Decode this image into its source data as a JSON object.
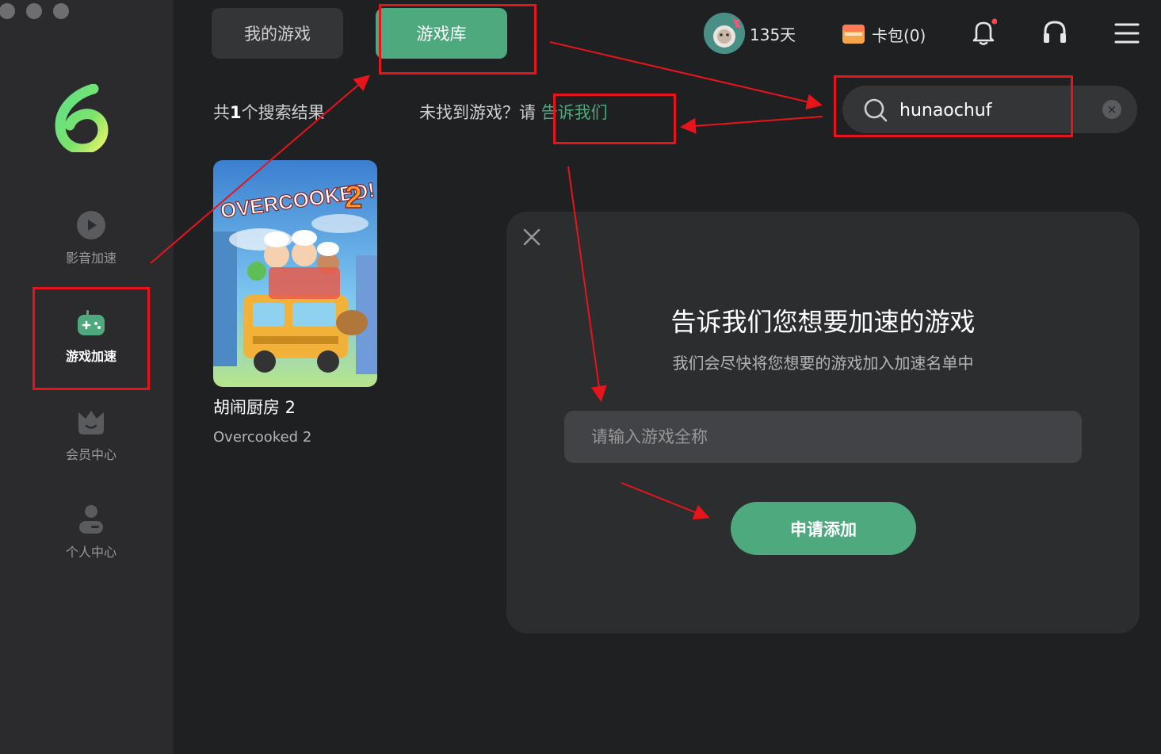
{
  "sidebar": {
    "items": [
      {
        "label": "影音加速",
        "icon": "play-circle-icon"
      },
      {
        "label": "游戏加速",
        "icon": "gamepad-icon"
      },
      {
        "label": "会员中心",
        "icon": "crown-icon"
      },
      {
        "label": "个人中心",
        "icon": "person-icon"
      }
    ]
  },
  "tabs": {
    "mine": "我的游戏",
    "library": "游戏库"
  },
  "header": {
    "days": "135天",
    "wallet": "卡包(0)"
  },
  "search": {
    "value": "hunaochuf",
    "clear": "×"
  },
  "results": {
    "count_prefix": "共",
    "count": "1",
    "count_suffix": "个搜索结果",
    "not_found": "未找到游戏？请",
    "tell_us": "告诉我们"
  },
  "game": {
    "title": "胡闹厨房 2",
    "subtitle": "Overcooked 2",
    "art_text": "OVERCOOKED!",
    "art_num": "2"
  },
  "modal": {
    "title": "告诉我们您想要加速的游戏",
    "subtitle": "我们会尽快将您想要的游戏加入加速名单中",
    "placeholder": "请输入游戏全称",
    "button": "申请添加"
  },
  "colors": {
    "accent": "#4ea97f",
    "annotation": "#e8141b"
  }
}
